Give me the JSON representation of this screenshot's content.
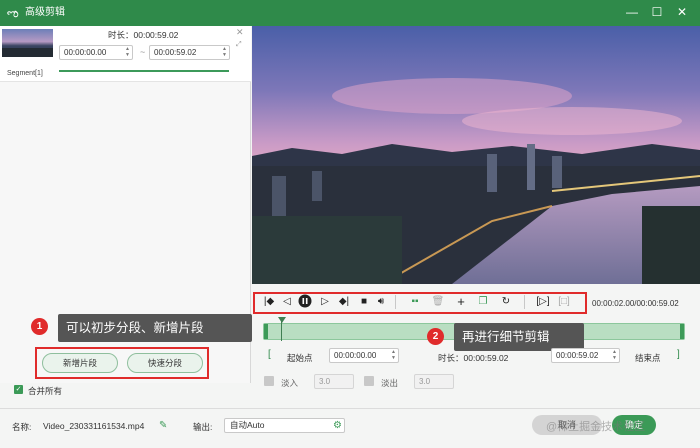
{
  "window": {
    "title": "高级剪辑",
    "minimize": "—",
    "maximize": "☐",
    "close": "✕"
  },
  "segment": {
    "label": "Segment[1]",
    "duration_label": "时长：00:00:59.02",
    "start": "00:00:00.00",
    "end": "00:00:59.02",
    "separator": "~"
  },
  "tips": {
    "tip1_number": "1",
    "tip1_text": "可以初步分段、新增片段",
    "tip2_number": "2",
    "tip2_text": "再进行细节剪辑"
  },
  "buttons": {
    "add_segment": "新增片段",
    "quick_split": "快速分段",
    "merge_all": "合并所有"
  },
  "player": {
    "timecode": "00:00:02.00/00:00:59.02"
  },
  "trim": {
    "start_btn": "起始点",
    "start_value": "00:00:00.00",
    "duration": "时长：00:00:59.02",
    "end_value": "00:00:59.02",
    "end_btn": "结束点",
    "fade_in_label": "淡入",
    "fade_in_value": "3.0",
    "fade_out_label": "淡出",
    "fade_out_value": "3.0"
  },
  "bottom": {
    "name_label": "名称:",
    "file_name": "Video_230331161534.mp4",
    "output_label": "输出:",
    "output_value": "自动Auto",
    "cancel_btn": "取消",
    "ok_btn": "确定",
    "watermark": "@稀土掘金技术社区"
  },
  "colors": {
    "brand_green": "#2f8a4a",
    "accent_red": "#e02b2b"
  }
}
